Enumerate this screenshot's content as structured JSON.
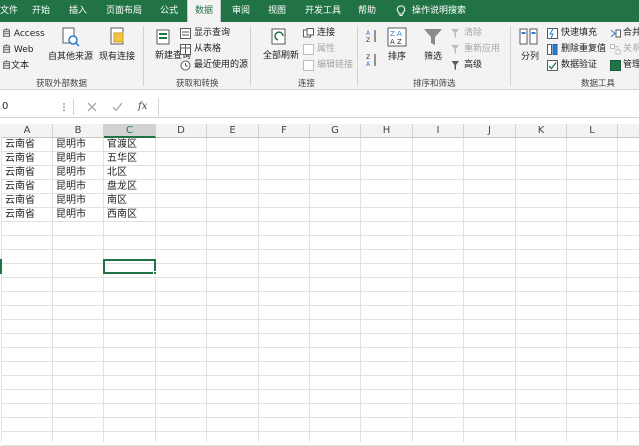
{
  "tabs": [
    "文件",
    "开始",
    "插入",
    "页面布局",
    "公式",
    "数据",
    "审阅",
    "视图",
    "开发工具",
    "帮助",
    "操作说明搜索"
  ],
  "ribbon": {
    "get_external": {
      "access": "自 Access",
      "web": "自 Web",
      "text": "自文本",
      "other": "自其他来源",
      "existing": "现有连接",
      "label": "获取外部数据"
    },
    "get_transform": {
      "new_query": "新建查询",
      "show_queries": "显示查询",
      "from_table": "从表格",
      "recent": "最近使用的源",
      "label": "获取和转换"
    },
    "connections": {
      "refresh_all": "全部刷新",
      "connections": "连接",
      "properties": "属性",
      "edit_links": "编辑链接",
      "label": "连接"
    },
    "sort_filter": {
      "sort": "排序",
      "filter": "筛选",
      "clear": "清除",
      "reapply": "重新应用",
      "advanced": "高级",
      "label": "排序和筛选"
    },
    "data_tools": {
      "split": "分列",
      "flash_fill": "快速填充",
      "remove_dup": "删除重复值",
      "validation": "数据验证",
      "consolidate": "合并",
      "relationships": "关系",
      "manage": "管理",
      "label": "数据工具"
    }
  },
  "formula_bar": {
    "name_box": "0",
    "fx": "fx",
    "value": ""
  },
  "columns": [
    "A",
    "B",
    "C",
    "D",
    "E",
    "F",
    "G",
    "H",
    "I",
    "J",
    "K",
    "L"
  ],
  "rows": [
    [
      "云南省",
      "昆明市",
      "官渡区"
    ],
    [
      "云南省",
      "昆明市",
      "五华区"
    ],
    [
      "云南省",
      "昆明市",
      "北区"
    ],
    [
      "云南省",
      "昆明市",
      "盘龙区"
    ],
    [
      "云南省",
      "昆明市",
      "南区"
    ],
    [
      "云南省",
      "昆明市",
      "西南区"
    ]
  ],
  "colors": {
    "accent": "#217346",
    "gridline": "#e1e1e1"
  }
}
